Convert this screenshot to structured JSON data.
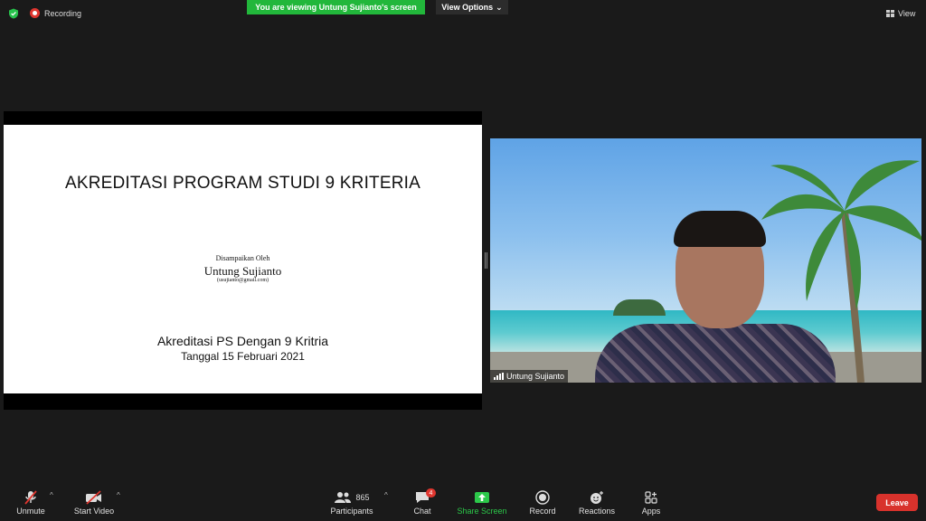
{
  "top": {
    "recording_label": "Recording",
    "viewing_banner": "You are viewing Untung Sujianto's screen",
    "view_options_label": "View Options",
    "view_label": "View"
  },
  "slide": {
    "title": "AKREDITASI PROGRAM STUDI 9 KRITERIA",
    "presented_by": "Disampaikan Oleh",
    "presenter": "Untung Sujianto",
    "email": "(usujianto@gmail.com)",
    "subtitle1": "Akreditasi PS Dengan 9 Kritria",
    "subtitle2": "Tanggal 15 Februari 2021"
  },
  "video": {
    "participant_name": "Untung Sujianto"
  },
  "toolbar": {
    "unmute": "Unmute",
    "start_video": "Start Video",
    "participants": "Participants",
    "participants_count": "865",
    "chat": "Chat",
    "chat_badge": "4",
    "share_screen": "Share Screen",
    "record": "Record",
    "reactions": "Reactions",
    "apps": "Apps",
    "leave": "Leave"
  },
  "colors": {
    "share_green": "#22b73b",
    "leave_red": "#d8322c",
    "recording_red": "#e0362f"
  }
}
